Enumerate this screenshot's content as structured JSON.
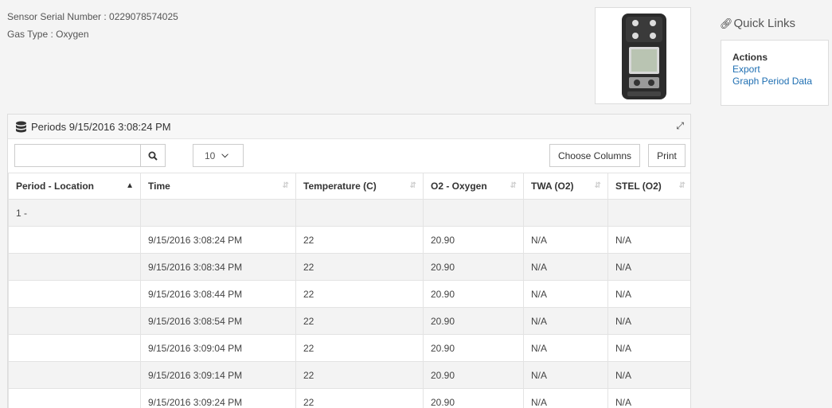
{
  "info": {
    "serial_label": "Sensor Serial Number : 0229078574025",
    "gas_label": "Gas Type : Oxygen"
  },
  "quick_links": {
    "title": "Quick Links",
    "actions_heading": "Actions",
    "links": [
      "Export",
      "Graph Period Data"
    ]
  },
  "panel": {
    "title": "Periods 9/15/2016 3:08:24 PM",
    "search_value": "",
    "page_size": "10",
    "choose_columns": "Choose Columns",
    "print": "Print"
  },
  "table": {
    "columns": [
      "Period - Location",
      "Time",
      "Temperature (C)",
      "O2 - Oxygen",
      "TWA (O2)",
      "STEL (O2)"
    ],
    "rows": [
      [
        "1 -",
        "",
        "",
        "",
        "",
        ""
      ],
      [
        "",
        "9/15/2016 3:08:24 PM",
        "22",
        "20.90",
        "N/A",
        "N/A"
      ],
      [
        "",
        "9/15/2016 3:08:34 PM",
        "22",
        "20.90",
        "N/A",
        "N/A"
      ],
      [
        "",
        "9/15/2016 3:08:44 PM",
        "22",
        "20.90",
        "N/A",
        "N/A"
      ],
      [
        "",
        "9/15/2016 3:08:54 PM",
        "22",
        "20.90",
        "N/A",
        "N/A"
      ],
      [
        "",
        "9/15/2016 3:09:04 PM",
        "22",
        "20.90",
        "N/A",
        "N/A"
      ],
      [
        "",
        "9/15/2016 3:09:14 PM",
        "22",
        "20.90",
        "N/A",
        "N/A"
      ],
      [
        "",
        "9/15/2016 3:09:24 PM",
        "22",
        "20.90",
        "N/A",
        "N/A"
      ]
    ]
  },
  "icons": {
    "link": "link-icon",
    "database": "database-icon",
    "expand": "expand-icon",
    "search": "search-icon",
    "chevron": "chevron-down-icon",
    "sort_asc": "sort-asc-icon",
    "sort_both": "sort-icon"
  },
  "colors": {
    "link": "#1f6fb2",
    "stripe": "#f3f3f3"
  }
}
